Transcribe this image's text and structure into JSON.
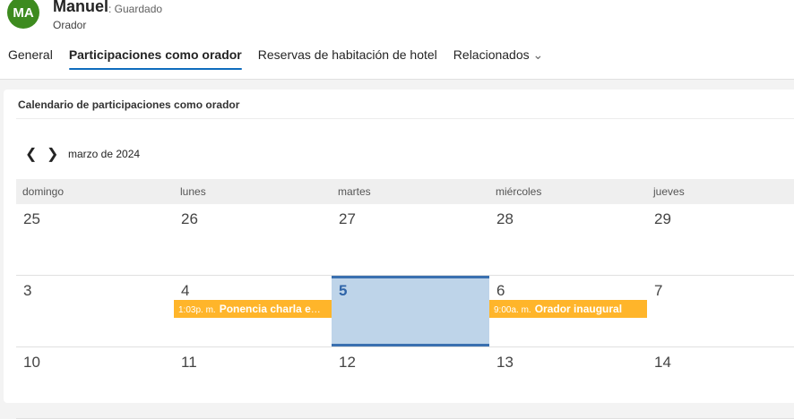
{
  "header": {
    "initials": "MA",
    "name": "Manuel",
    "status": ": Guardado",
    "entity": "Orador"
  },
  "tabs": [
    "General",
    "Participaciones como orador",
    "Reservas de habitación de hotel",
    "Relacionados"
  ],
  "card": {
    "title": "Calendario de participaciones como orador",
    "month": "marzo de 2024"
  },
  "weekdays": [
    "domingo",
    "lunes",
    "martes",
    "miércoles",
    "jueves"
  ],
  "weeks": [
    [
      "25",
      "26",
      "27",
      "28",
      "29"
    ],
    [
      "3",
      "4",
      "5",
      "6",
      "7"
    ],
    [
      "10",
      "11",
      "12",
      "13",
      "14"
    ]
  ],
  "events": [
    {
      "time": "1:03p. m.",
      "title": "Ponencia charla educativa"
    },
    {
      "time": "9:00a. m.",
      "title": "Orador inaugural"
    }
  ]
}
